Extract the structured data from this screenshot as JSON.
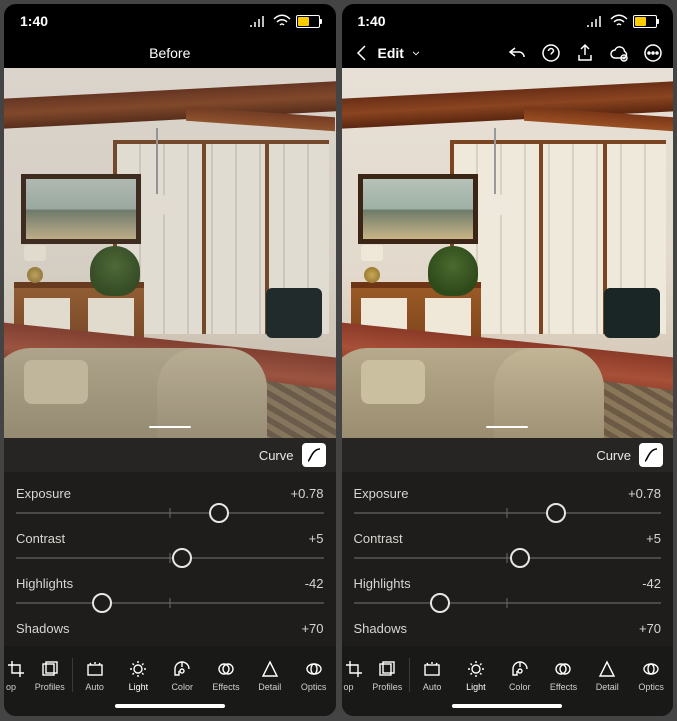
{
  "status": {
    "time": "1:40"
  },
  "left_screen": {
    "header_title": "Before"
  },
  "right_screen": {
    "header_title": "Edit"
  },
  "curve_label": "Curve",
  "sliders": [
    {
      "label": "Exposure",
      "value": "+0.78",
      "pos": 66
    },
    {
      "label": "Contrast",
      "value": "+5",
      "pos": 54
    },
    {
      "label": "Highlights",
      "value": "-42",
      "pos": 28
    },
    {
      "label": "Shadows",
      "value": "+70",
      "pos": 86
    }
  ],
  "tools": [
    {
      "label": "op",
      "name": "crop"
    },
    {
      "label": "Profiles",
      "name": "profiles"
    },
    {
      "label": "Auto",
      "name": "auto"
    },
    {
      "label": "Light",
      "name": "light",
      "active": true
    },
    {
      "label": "Color",
      "name": "color"
    },
    {
      "label": "Effects",
      "name": "effects"
    },
    {
      "label": "Detail",
      "name": "detail"
    },
    {
      "label": "Optics",
      "name": "optics"
    }
  ]
}
